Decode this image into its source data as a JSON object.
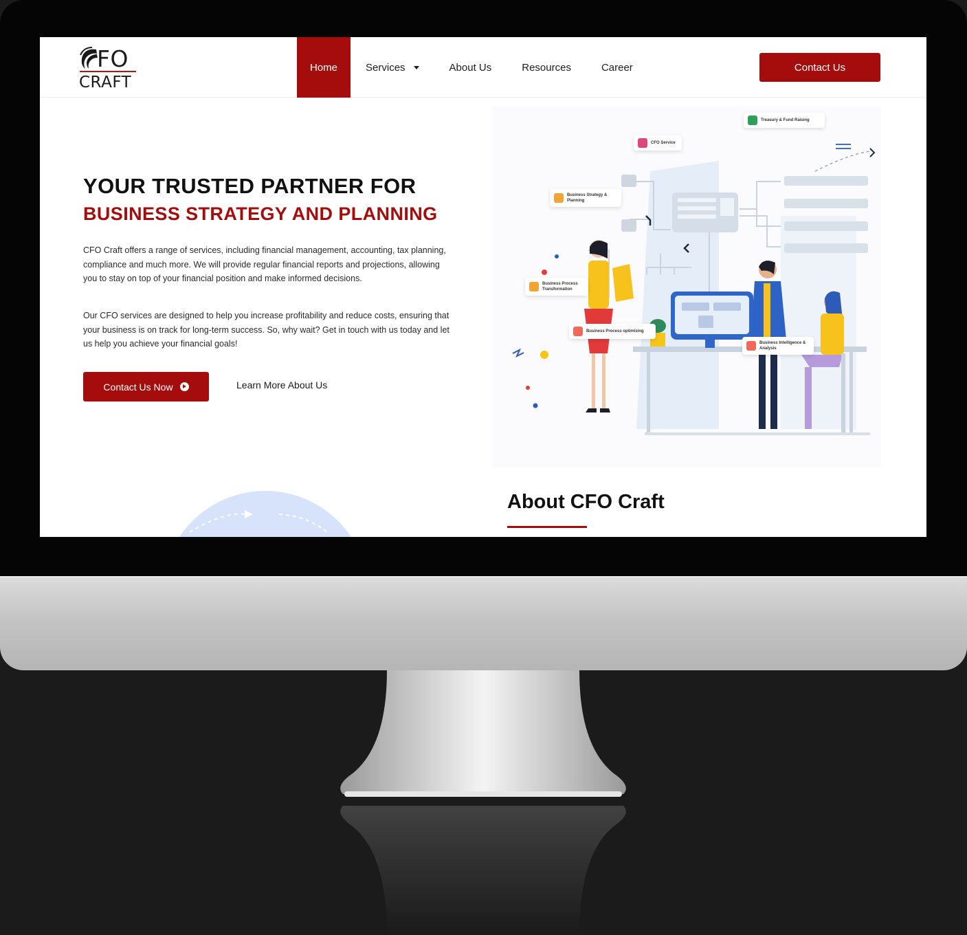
{
  "logo": {
    "line1": "FO",
    "line2": "CRAFT"
  },
  "nav": {
    "items": [
      {
        "label": "Home",
        "active": true
      },
      {
        "label": "Services",
        "has_dropdown": true
      },
      {
        "label": "About Us"
      },
      {
        "label": "Resources"
      },
      {
        "label": "Career"
      }
    ],
    "cta": "Contact Us"
  },
  "hero": {
    "title_line1": "YOUR TRUSTED PARTNER FOR",
    "title_line2": "BUSINESS STRATEGY AND PLANNING",
    "paragraph1": "CFO Craft offers a range of services, including financial management, accounting, tax planning, compliance and much more. We will provide regular financial reports and projections, allowing you to stay on top of your financial position and make informed decisions.",
    "paragraph2": "Our CFO services are designed to help you increase profitability and reduce costs, ensuring that your business is on track for long-term success. So, why wait? Get in touch with us today and let us help you achieve your financial goals!",
    "primary_button": "Contact Us Now",
    "secondary_link": "Learn More About Us"
  },
  "illustration": {
    "tags": [
      {
        "label": "Treasury & Fund Raising",
        "color": "#2f9e5b"
      },
      {
        "label": "CFO Service",
        "color": "#e0457b"
      },
      {
        "label": "Business Strategy & Planning",
        "color": "#f0a535"
      },
      {
        "label": "Business Process Transformation",
        "color": "#f0a535"
      },
      {
        "label": "Business Process optimising",
        "color": "#ef6a5a"
      },
      {
        "label": "Business Intelligence & Analysis",
        "color": "#ef6a5a"
      }
    ]
  },
  "about": {
    "title": "About CFO Craft"
  },
  "colors": {
    "brand": "#a50d0d",
    "text": "#111111"
  }
}
